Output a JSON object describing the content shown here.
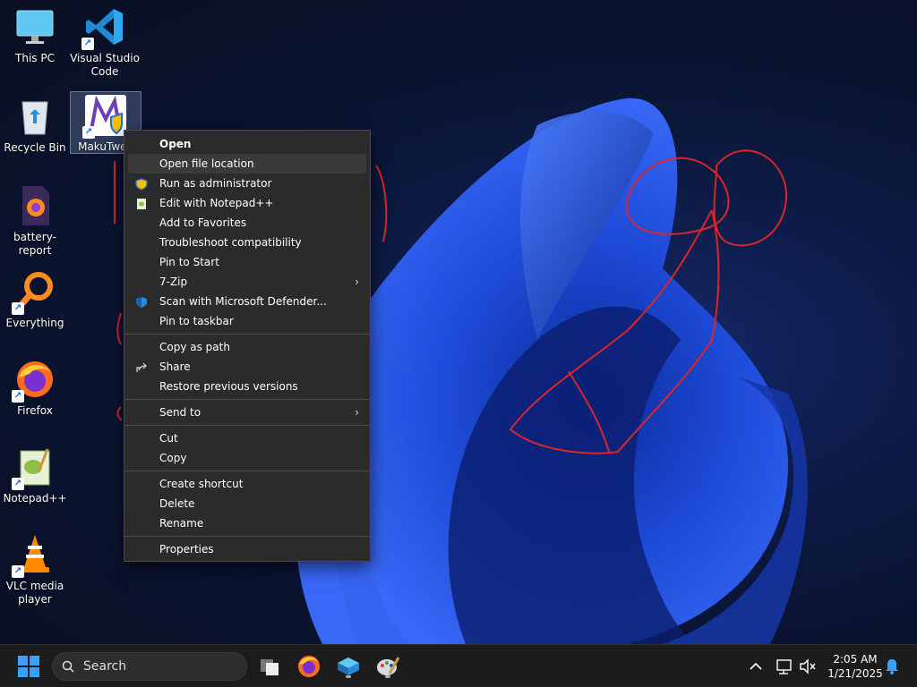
{
  "desktop": {
    "icons": [
      {
        "label": "This PC"
      },
      {
        "label": "Visual Studio Code"
      },
      {
        "label": "Recycle Bin"
      },
      {
        "label": "MakuTwea"
      },
      {
        "label": "battery-report"
      },
      {
        "label": "Everything"
      },
      {
        "label": "Firefox"
      },
      {
        "label": "Notepad++"
      },
      {
        "label": "VLC media player"
      }
    ]
  },
  "context_menu": {
    "items": [
      {
        "label": "Open"
      },
      {
        "label": "Open file location"
      },
      {
        "label": "Run as administrator"
      },
      {
        "label": "Edit with Notepad++"
      },
      {
        "label": "Add to Favorites"
      },
      {
        "label": "Troubleshoot compatibility"
      },
      {
        "label": "Pin to Start"
      },
      {
        "label": "7-Zip"
      },
      {
        "label": "Scan with Microsoft Defender..."
      },
      {
        "label": "Pin to taskbar"
      },
      {
        "label": "Copy as path"
      },
      {
        "label": "Share"
      },
      {
        "label": "Restore previous versions"
      },
      {
        "label": "Send to"
      },
      {
        "label": "Cut"
      },
      {
        "label": "Copy"
      },
      {
        "label": "Create shortcut"
      },
      {
        "label": "Delete"
      },
      {
        "label": "Rename"
      },
      {
        "label": "Properties"
      }
    ]
  },
  "taskbar": {
    "search_label": "Search",
    "apps": [
      "start-icon",
      "task-view-icon",
      "firefox-icon",
      "app-icon",
      "paint-icon"
    ],
    "tray_icons": [
      "chevron-up-icon",
      "network-icon",
      "volume-muted-icon",
      "notification-bell-icon"
    ],
    "clock": {
      "time": "2:05 AM",
      "date": "1/21/2025"
    }
  },
  "colors": {
    "menu_bg": "#2b2b2b",
    "taskbar_bg": "#1c1c1c",
    "accent": "#1a5fd6",
    "annotation": "#d9262a"
  }
}
